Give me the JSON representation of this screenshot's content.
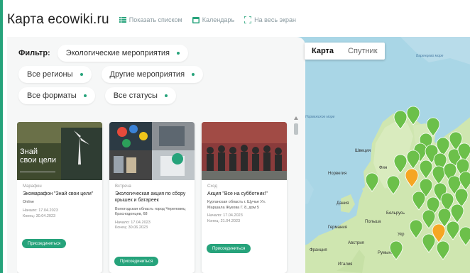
{
  "header": {
    "title": "Карта ecowiki.ru",
    "links": [
      {
        "label": "Показать списком",
        "icon": "list-icon"
      },
      {
        "label": "Календарь",
        "icon": "calendar-icon"
      },
      {
        "label": "На весь экран",
        "icon": "fullscreen-icon"
      }
    ]
  },
  "filters": {
    "label": "Фильтр:",
    "category": "Экологические мероприятия",
    "region": "Все регионы",
    "other": "Другие мероприятия",
    "format": "Все форматы",
    "status": "Все статусы"
  },
  "cards": [
    {
      "image_text_1": "Знай",
      "image_text_2": "свои цели",
      "type": "Марафон",
      "title": "Экомарафон \"Знай свои цели\"",
      "place": "Online",
      "start": "Начало: 17.04.2023",
      "end": "Конец: 30.04.2023",
      "button": "Присоединиться"
    },
    {
      "type": "Встреча",
      "title": "Экологическая акция по сбору крышек и батареек",
      "place": "Вологодская область город Череповец Краснодонцев, 68",
      "start": "Начало: 17.04.2023",
      "end": "Конец: 30.06.2023",
      "button": "Присоединиться"
    },
    {
      "type": "Сход",
      "title": "Акция \"Все на субботник!\"",
      "place": "Курганская область г. Щучье Ул. Маршала Жукова Г. 8, дом 5",
      "start": "Начало: 17.04.2023",
      "end": "Конец: 21.04.2023",
      "button": "Присоединиться"
    }
  ],
  "map": {
    "tabs": [
      "Карта",
      "Спутник"
    ],
    "active_tab": "Карта",
    "labels": {
      "barents": "Баренцево море",
      "norwegian": "Норвежское море",
      "sweden": "Швеция",
      "finland": "Фин",
      "norway": "Норвегия",
      "denmark": "Дания",
      "belarus": "Бельрусь",
      "poland": "Польша",
      "germany": "Германия",
      "ukraine": "Укр",
      "austria": "Австрия",
      "france": "Франция",
      "romania": "Румыния",
      "italy": "Италия"
    },
    "colors": {
      "water": "#a9d6e6",
      "land": "#cfe6b0",
      "marker_green": "#6cc04a",
      "marker_orange": "#f5a623"
    }
  }
}
